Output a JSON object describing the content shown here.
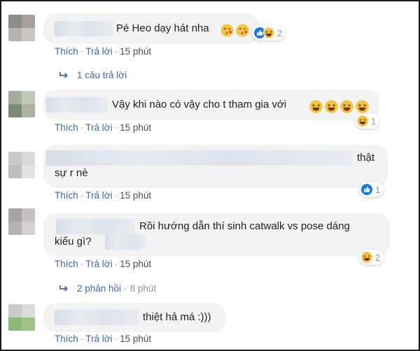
{
  "colors": {
    "link": "#4267b2",
    "meta": "#90949c",
    "bubble": "#f2f3f5",
    "text": "#1c1e21"
  },
  "comments": [
    {
      "text": "Pé Heo dạy hát nha",
      "emojis": [
        "kissing-heart-emoji",
        "kissing-heart-emoji"
      ],
      "reactions": {
        "icons": [
          "like-icon",
          "laugh-icon"
        ],
        "count": "2"
      },
      "actions": {
        "like": "Thích",
        "reply": "Trả lời",
        "time": "15 phút"
      }
    },
    {
      "text": "Vậy khi nào có vậy cho t tham gia với",
      "emojis": [
        "laughing-emoji",
        "laughing-emoji",
        "laughing-emoji",
        "laughing-emoji"
      ],
      "reactions": {
        "icons": [
          "laugh-icon"
        ],
        "count": "1"
      },
      "actions": {
        "like": "Thích",
        "reply": "Trả lời",
        "time": "15 phút"
      }
    },
    {
      "text_line1": "thật",
      "text_line2": "sự r nè",
      "reactions": {
        "icons": [
          "like-icon"
        ],
        "count": "1"
      },
      "actions": {
        "like": "Thích",
        "reply": "Trả lời",
        "time": "15 phút"
      }
    },
    {
      "text_line1": "Rồi hướng dẫn thí sinh catwalk vs pose dáng",
      "text_line2": "kiểu gì?",
      "reactions": {
        "icons": [
          "laugh-icon"
        ],
        "count": "2"
      },
      "actions": {
        "like": "Thích",
        "reply": "Trả lời",
        "time": "15 phút"
      }
    },
    {
      "text": "thiệt hả má :)))",
      "actions": {
        "like": "Thích",
        "reply": "Trả lời",
        "time": "15 phút"
      }
    }
  ],
  "reply_threads": [
    {
      "label": "1 câu trả lời"
    },
    {
      "label": "2 phản hồi",
      "time": "8 phút"
    }
  ]
}
